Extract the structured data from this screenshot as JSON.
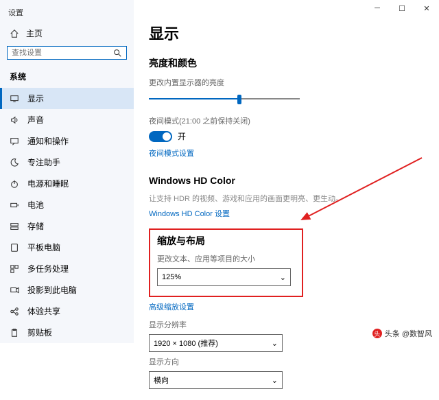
{
  "app": {
    "title": "设置"
  },
  "sidebar": {
    "home": "主页",
    "search_placeholder": "查找设置",
    "group": "系统",
    "items": [
      {
        "label": "显示"
      },
      {
        "label": "声音"
      },
      {
        "label": "通知和操作"
      },
      {
        "label": "专注助手"
      },
      {
        "label": "电源和睡眠"
      },
      {
        "label": "电池"
      },
      {
        "label": "存储"
      },
      {
        "label": "平板电脑"
      },
      {
        "label": "多任务处理"
      },
      {
        "label": "投影到此电脑"
      },
      {
        "label": "体验共享"
      },
      {
        "label": "剪贴板"
      }
    ]
  },
  "main": {
    "title": "显示",
    "brightness": {
      "heading": "亮度和颜色",
      "label": "更改内置显示器的亮度"
    },
    "nightlight": {
      "label": "夜间模式(21:00 之前保持关闭)",
      "state": "开",
      "settings": "夜间模式设置"
    },
    "hdr": {
      "heading": "Windows HD Color",
      "desc": "让支持 HDR 的视频、游戏和应用的画面更明亮、更生动。",
      "link": "Windows HD Color 设置"
    },
    "scale": {
      "heading": "缩放与布局",
      "label": "更改文本、应用等项目的大小",
      "value": "125%",
      "advanced": "高级缩放设置"
    },
    "resolution": {
      "label": "显示分辨率",
      "value": "1920 × 1080 (推荐)"
    },
    "orientation": {
      "label": "显示方向",
      "value": "横向"
    }
  },
  "watermark": "头条 @数智风"
}
